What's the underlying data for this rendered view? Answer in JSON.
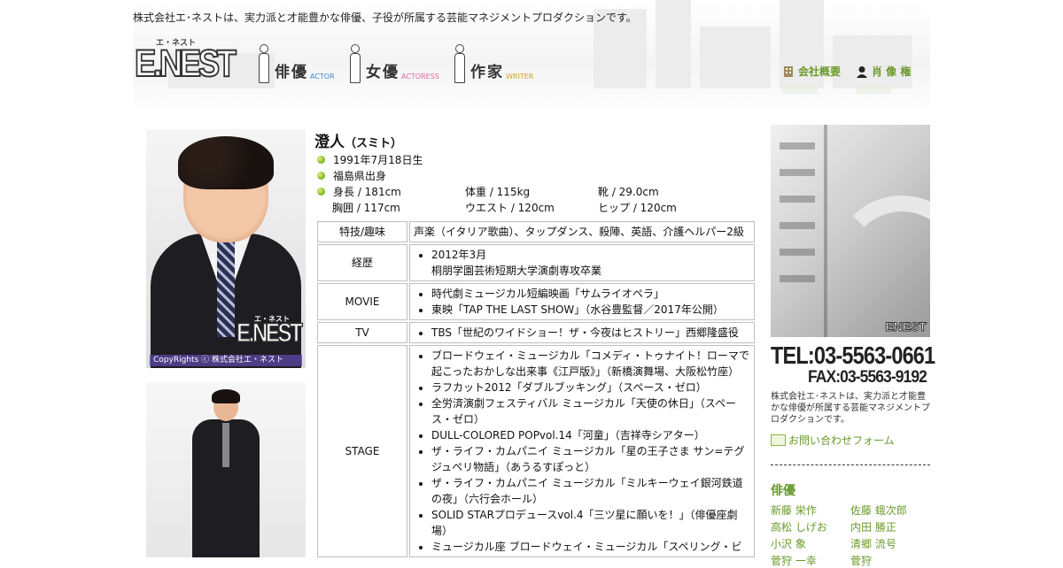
{
  "header": {
    "tagline": "株式会社エ･ネストは、実力派と才能豊かな俳優、子役が所属する芸能マネジメントプロダクションです。",
    "logo_small": "エ・ネスト",
    "logo_text": "E.NEST",
    "nav": [
      {
        "ja": "俳優",
        "en": "ACTOR",
        "color": "#3a8ad0"
      },
      {
        "ja": "女優",
        "en": "ACTORESS",
        "color": "#e0669b"
      },
      {
        "ja": "作家",
        "en": "WRITER",
        "color": "#d2a21c"
      }
    ],
    "util": [
      {
        "label": "会社概要",
        "icon": "building-icon"
      },
      {
        "label": "肖 像 権",
        "icon": "person-silhouette-icon"
      }
    ]
  },
  "profile": {
    "name": "澄人",
    "kana": "（スミト）",
    "birthday": "1991年7月18日生",
    "birthplace": "福島県出身",
    "height": "身長 / 181cm",
    "weight": "体重 / 115kg",
    "shoe": "靴 / 29.0cm",
    "chest": "胸囲 / 117cm",
    "waist": "ウエスト / 120cm",
    "hip": "ヒップ / 120cm",
    "photo_copyright": "CopyRights ⓒ 株式会社エ・ネスト",
    "watermark": "E.NEST",
    "watermark_small": "エ・ネスト"
  },
  "career": [
    {
      "head": "特技/趣味",
      "text": "声楽（イタリア歌曲）、タップダンス、殺陣、英語、介護ヘルパー2級"
    },
    {
      "head": "経歴",
      "items": [
        "2012年3月\n桐朋学園芸術短期大学演劇専攻卒業"
      ]
    },
    {
      "head": "MOVIE",
      "items": [
        "時代劇ミュージカル短編映画「サムライオペラ」",
        "東映「TAP THE LAST SHOW」（水谷豊監督／2017年公開）"
      ]
    },
    {
      "head": "TV",
      "items": [
        "TBS「世紀のワイドショー！ザ・今夜はヒストリー」西郷隆盛役"
      ]
    },
    {
      "head": "STAGE",
      "items": [
        "ブロードウェイ・ミュージカル「コメディ・トゥナイト！ローマで起こったおかしな出来事《江戸版》」（新橋演舞場、大阪松竹座）",
        "ラフカット2012「ダブルブッキング」（スペース・ゼロ）",
        "全労済演劇フェスティバル ミュージカル「天使の休日」（スペース・ゼロ）",
        "DULL-COLORED POPvol.14「河童」（吉祥寺シアター）",
        "ザ・ライフ・カムパニイ ミュージカル「星の王子さま サン=テグジュペリ物語」（あうるすぽっと）",
        "ザ・ライフ・カムパニイ ミュージカル「ミルキーウェイ銀河鉄道の夜」（六行会ホール）",
        "SOLID STARプロデュースvol.4「三ツ星に願いを！」（俳優座劇場）",
        "ミュージカル座 ブロードウェイ・ミュージカル「スペリング・ビ"
      ]
    }
  ],
  "sidebar": {
    "building_logo": "ENEST",
    "tel": "TEL:03-5563-0661",
    "fax": "FAX:03-5563-9192",
    "description": "株式会社エ･ネストは、実力派と才能豊かな俳優が所属する芸能マネジメントプロダクションです。",
    "contact_label": "お問い合わせフォーム",
    "section_title": "俳優",
    "actors": [
      "新藤 栄作",
      "佐藤 蛾次郎",
      "高松 しげお",
      "内田 勝正",
      "小沢 象",
      "清郷 流号",
      "菅狩 一幸",
      "菅狩"
    ]
  }
}
